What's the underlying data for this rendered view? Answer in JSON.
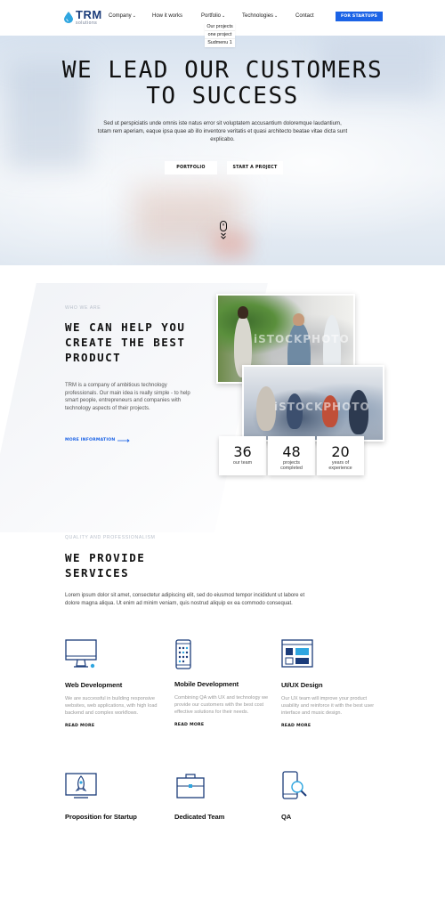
{
  "brand": {
    "logo_main": "TRM",
    "logo_sub": "solutions",
    "accent": "#1b63e6",
    "dark_blue": "#1b3c7a"
  },
  "nav": {
    "items": [
      {
        "label": "Company",
        "caret": "⌄"
      },
      {
        "label": "How it works",
        "caret": ""
      },
      {
        "label": "Portfolio",
        "caret": "⌄"
      },
      {
        "label": "Technologies",
        "caret": "⌄"
      },
      {
        "label": "Contact",
        "caret": ""
      }
    ],
    "cta": "FOR STARTUPS",
    "dropdown": [
      "Our projects",
      "one project",
      "Sudmenu 1"
    ]
  },
  "hero": {
    "title_line1": "WE LEAD OUR CUSTOMERS",
    "title_line2": "TO SUCCESS",
    "subtitle": "Sed ut perspiciatis unde omnis iste natus error sit voluptatem accusantium doloremque laudantium, totam rem aperiam, eaque ipsa quae ab illo inventore veritatis et quasi architecto beatae vitae dicta sunt explicabo.",
    "btn_portfolio": "PORTFOLIO",
    "btn_start": "START A PROJECT"
  },
  "who": {
    "eyebrow": "WHO WE ARE",
    "title_line1": "WE CAN HELP YOU",
    "title_line2": "CREATE THE BEST",
    "title_line3": "PRODUCT",
    "text": "TRM is a company of ambitious technology professionals. Our main idea is really simple - to help smart people, entrepreneurs and companies with technology aspects of their projects.",
    "more": "MORE INFORMATION",
    "watermark1": "iSTOCKPHOTO",
    "watermark2": "iSTOCKPHOTO",
    "stats": [
      {
        "value": "36",
        "label": "our team"
      },
      {
        "value": "48",
        "label": "projects completed"
      },
      {
        "value": "20",
        "label": "years of experience"
      }
    ]
  },
  "services": {
    "eyebrow": "QUALITY AND PROFESSIONALISM",
    "title_line1": "WE PROVIDE",
    "title_line2": "SERVICES",
    "text": "Lorem ipsum dolor sit amet, consectetur adipiscing elit, sed do eiusmod tempor incididunt ut labore et dolore magna aliqua. Ut enim ad minim veniam, quis nostrud aliquip ex ea commodo consequat.",
    "items": [
      {
        "icon": "monitor-icon",
        "title": "Web Development",
        "desc": "We are successful in building responsive websites, web applications, with high load backend and complex workflows.",
        "more": "READ MORE"
      },
      {
        "icon": "mobile-icon",
        "title": "Mobile Development",
        "desc": "Combining QA with UX and technology we provide our customers with the best cost effective solutions for their needs.",
        "more": "READ MORE"
      },
      {
        "icon": "ui-layout-icon",
        "title": "UI/UX Design",
        "desc": "Our UX team will improve your product usability and reinforce it with the best user interface and music design.",
        "more": "READ MORE"
      },
      {
        "icon": "rocket-icon",
        "title": "Proposition for Startup"
      },
      {
        "icon": "briefcase-icon",
        "title": "Dedicated Team"
      },
      {
        "icon": "magnifier-phone-icon",
        "title": "QA"
      }
    ]
  }
}
